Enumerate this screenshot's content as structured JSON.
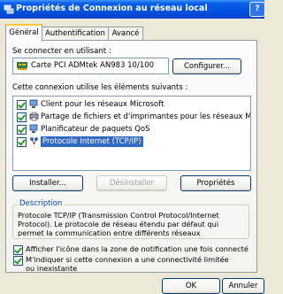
{
  "window": {
    "title": "Propriétés de Connexion au réseau local",
    "help_label": "?",
    "close_label": "×"
  },
  "tabs": [
    {
      "label": "Général",
      "active": true
    },
    {
      "label": "Authentification",
      "active": false
    },
    {
      "label": "Avancé",
      "active": false
    }
  ],
  "general": {
    "connect_using_label": "Se connecter en utilisant :",
    "adapter_name": "Carte PCI ADMtek AN983 10/100",
    "configure_button": "Configurer...",
    "components_label": "Cette connexion utilise les éléments suivants :",
    "components": [
      {
        "label": "Client pour les réseaux Microsoft",
        "checked": true,
        "icon": "network-client-icon"
      },
      {
        "label": "Partage de fichiers et d'imprimantes pour les réseaux Mi...",
        "checked": true,
        "icon": "printer-share-icon"
      },
      {
        "label": "Planificateur de paquets QoS",
        "checked": true,
        "icon": "qos-scheduler-icon"
      },
      {
        "label": "Protocole Internet (TCP/IP)",
        "checked": true,
        "icon": "protocol-icon",
        "selected": true
      }
    ],
    "install_button": "Installer...",
    "uninstall_button": "Désinstaller",
    "properties_button": "Propriétés",
    "description_title": "Description",
    "description_text": "Protocole TCP/IP (Transmission Control Protocol/Internet Protocol). Le protocole de réseau étendu par défaut qui permet la communication entre différents réseaux interconnectés.",
    "show_icon_label": "Afficher l'icône dans la zone de notification une fois connecté",
    "notify_label": "M'indiquer si cette connexion a une connectivité limitée ou inexistante"
  },
  "footer": {
    "ok_button": "OK",
    "cancel_button": "Annuler"
  },
  "colors": {
    "titlebar": "#0054e3",
    "selection": "#316ac5",
    "dialog_bg": "#ece9d8"
  }
}
